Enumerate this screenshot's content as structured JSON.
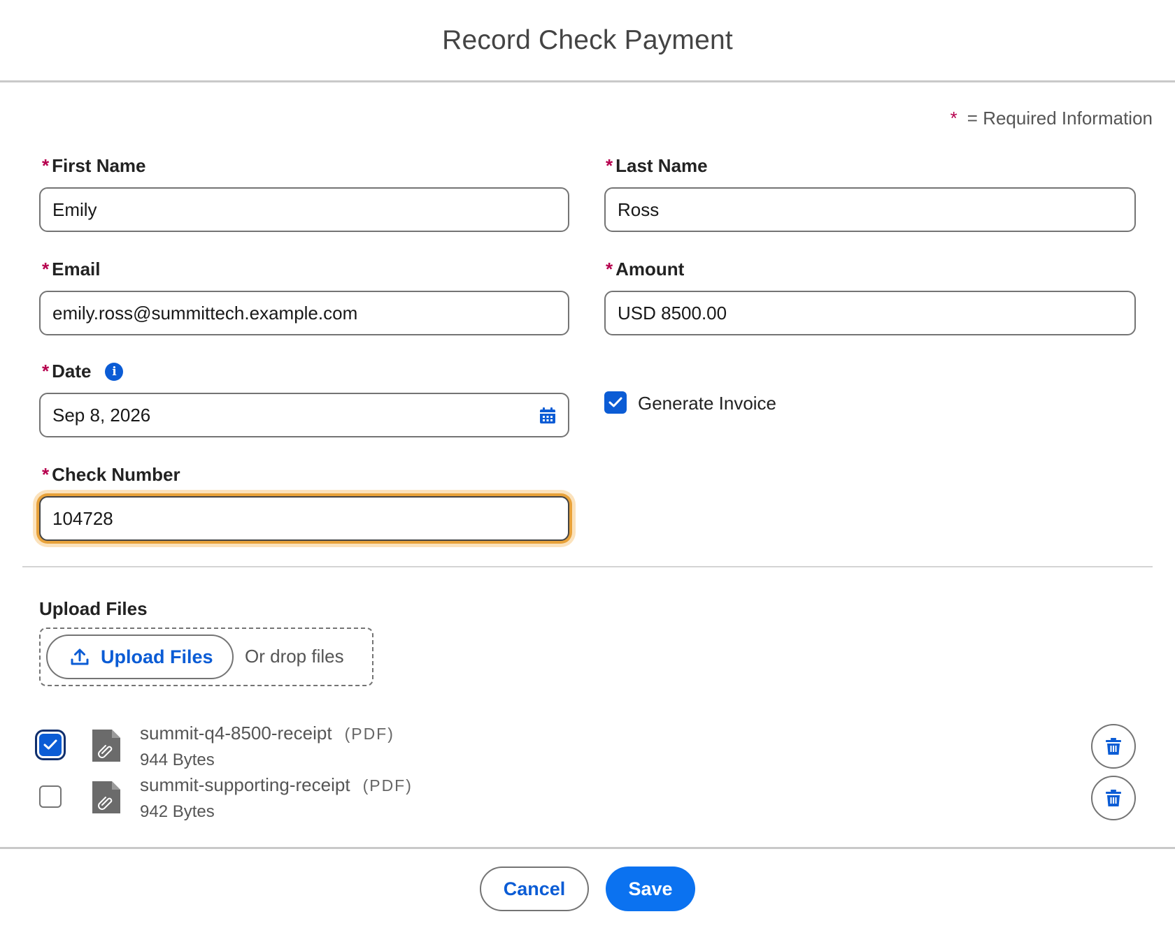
{
  "modal": {
    "title": "Record Check Payment",
    "required_legend": "= Required Information",
    "required_marker": "*"
  },
  "form": {
    "first_name": {
      "label": "First Name",
      "value": "Emily"
    },
    "last_name": {
      "label": "Last Name",
      "value": "Ross"
    },
    "email": {
      "label": "Email",
      "value": "emily.ross@summittech.example.com"
    },
    "amount": {
      "label": "Amount",
      "value": "USD 8500.00"
    },
    "date": {
      "label": "Date",
      "value": "Sep 8, 2026",
      "info_icon": "i"
    },
    "generate_invoice": {
      "label": "Generate Invoice",
      "checked": true
    },
    "check_number": {
      "label": "Check Number",
      "value": "104728"
    }
  },
  "upload": {
    "section_title": "Upload Files",
    "button_label": "Upload Files",
    "drop_text": "Or drop files",
    "files": [
      {
        "name": "summit-q4-8500-receipt",
        "type": "(PDF)",
        "size": "944 Bytes",
        "selected": true
      },
      {
        "name": "summit-supporting-receipt",
        "type": "(PDF)",
        "size": "942 Bytes",
        "selected": false
      }
    ]
  },
  "footer": {
    "cancel_label": "Cancel",
    "save_label": "Save"
  },
  "colors": {
    "brand_blue": "#0b5cd5",
    "save_blue": "#0b72f0",
    "required_red": "#b6004e",
    "focus_orange": "#e8a23a"
  }
}
